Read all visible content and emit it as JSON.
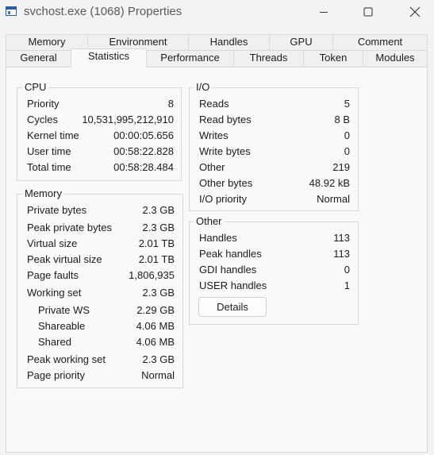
{
  "window": {
    "title": "svchost.exe (1068) Properties"
  },
  "icons": {
    "app": "window-icon",
    "minimize": "minimize-icon",
    "maximize": "maximize-icon",
    "close": "close-icon"
  },
  "tabs": {
    "row1": [
      "Memory",
      "Environment",
      "Handles",
      "GPU",
      "Comment"
    ],
    "row2": [
      "General",
      "Statistics",
      "Performance",
      "Threads",
      "Token",
      "Modules"
    ],
    "active": "Statistics"
  },
  "cpu": {
    "title": "CPU",
    "rows": [
      {
        "label": "Priority",
        "value": "8"
      },
      {
        "label": "Cycles",
        "value": "10,531,995,212,910"
      },
      {
        "label": "Kernel time",
        "value": "00:00:05.656"
      },
      {
        "label": "User time",
        "value": "00:58:22.828"
      },
      {
        "label": "Total time",
        "value": "00:58:28.484"
      }
    ]
  },
  "memory": {
    "title": "Memory",
    "rows": [
      {
        "label": "Private bytes",
        "value": "2.3 GB"
      },
      {
        "label": "Peak private bytes",
        "value": "2.3 GB"
      },
      {
        "label": "Virtual size",
        "value": "2.01 TB"
      },
      {
        "label": "Peak virtual size",
        "value": "2.01 TB"
      },
      {
        "label": "Page faults",
        "value": "1,806,935"
      },
      {
        "label": "Working set",
        "value": "2.3 GB"
      },
      {
        "label": "Private WS",
        "value": "2.29 GB"
      },
      {
        "label": "Shareable",
        "value": "4.06 MB"
      },
      {
        "label": "Shared",
        "value": "4.06 MB"
      },
      {
        "label": "Peak working set",
        "value": "2.3 GB"
      },
      {
        "label": "Page priority",
        "value": "Normal"
      }
    ]
  },
  "io": {
    "title": "I/O",
    "rows": [
      {
        "label": "Reads",
        "value": "5"
      },
      {
        "label": "Read bytes",
        "value": "8 B"
      },
      {
        "label": "Writes",
        "value": "0"
      },
      {
        "label": "Write bytes",
        "value": "0"
      },
      {
        "label": "Other",
        "value": "219"
      },
      {
        "label": "Other bytes",
        "value": "48.92 kB"
      },
      {
        "label": "I/O priority",
        "value": "Normal"
      }
    ]
  },
  "other": {
    "title": "Other",
    "rows": [
      {
        "label": "Handles",
        "value": "113"
      },
      {
        "label": "Peak handles",
        "value": "113"
      },
      {
        "label": "GDI handles",
        "value": "0"
      },
      {
        "label": "USER handles",
        "value": "1"
      }
    ],
    "details_label": "Details"
  }
}
